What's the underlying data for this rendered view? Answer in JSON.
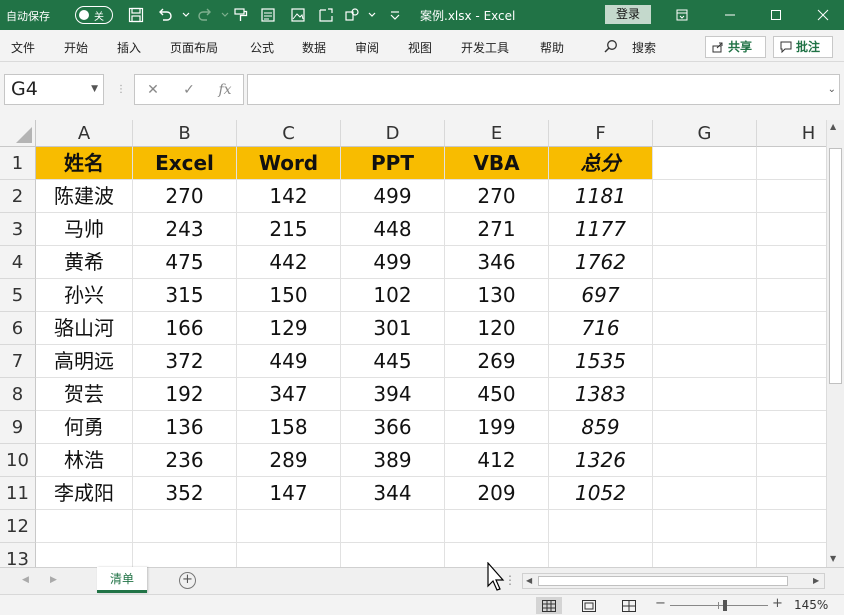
{
  "titlebar": {
    "autosave_label": "自动保存",
    "autosave_state": "关",
    "doc_title": "案例.xlsx  -  Excel",
    "login_label": "登录",
    "bg_color": "#217346"
  },
  "ribbon": {
    "menus": [
      "文件",
      "开始",
      "插入",
      "页面布局",
      "公式",
      "数据",
      "审阅",
      "视图",
      "开发工具",
      "帮助"
    ],
    "search_label": "搜索",
    "share_label": "共享",
    "comment_label": "批注"
  },
  "formula_bar": {
    "name_box": "G4",
    "fx_label": "fx",
    "formula": ""
  },
  "grid": {
    "columns": [
      "A",
      "B",
      "C",
      "D",
      "E",
      "F",
      "G",
      "H"
    ],
    "rows": [
      "1",
      "2",
      "3",
      "4",
      "5",
      "6",
      "7",
      "8",
      "9",
      "10",
      "11",
      "12",
      "13"
    ],
    "header_fill": "#f8bc00",
    "table_header": [
      "姓名",
      "Excel",
      "Word",
      "PPT",
      "VBA",
      "总分"
    ],
    "table_rows": [
      [
        "陈建波",
        "270",
        "142",
        "499",
        "270",
        "1181"
      ],
      [
        "马帅",
        "243",
        "215",
        "448",
        "271",
        "1177"
      ],
      [
        "黄希",
        "475",
        "442",
        "499",
        "346",
        "1762"
      ],
      [
        "孙兴",
        "315",
        "150",
        "102",
        "130",
        "697"
      ],
      [
        "骆山河",
        "166",
        "129",
        "301",
        "120",
        "716"
      ],
      [
        "高明远",
        "372",
        "449",
        "445",
        "269",
        "1535"
      ],
      [
        "贺芸",
        "192",
        "347",
        "394",
        "450",
        "1383"
      ],
      [
        "何勇",
        "136",
        "158",
        "366",
        "199",
        "859"
      ],
      [
        "林浩",
        "236",
        "289",
        "389",
        "412",
        "1326"
      ],
      [
        "李成阳",
        "352",
        "147",
        "344",
        "209",
        "1052"
      ]
    ]
  },
  "sheets": {
    "active": "清单",
    "add_label": "+"
  },
  "statusbar": {
    "zoom": "145%",
    "minus": "−",
    "plus": "+"
  }
}
